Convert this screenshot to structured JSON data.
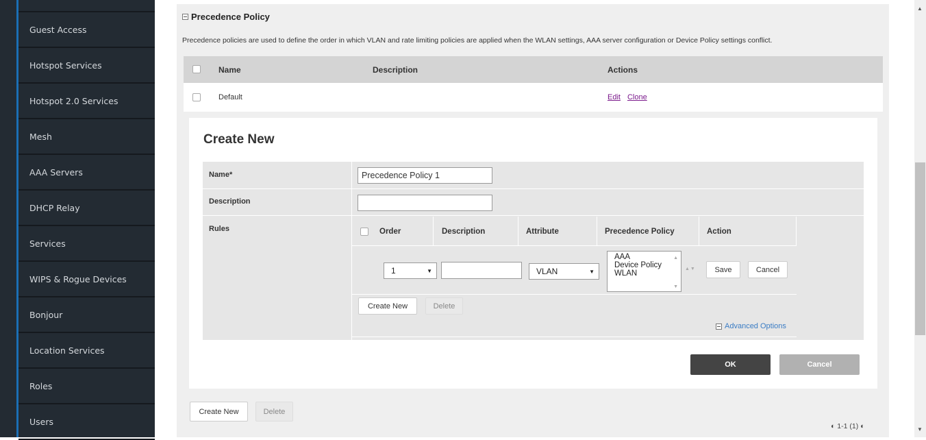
{
  "sidebar": {
    "items": [
      {
        "label": "Guest Access"
      },
      {
        "label": "Hotspot Services"
      },
      {
        "label": "Hotspot 2.0 Services"
      },
      {
        "label": "Mesh"
      },
      {
        "label": "AAA Servers"
      },
      {
        "label": "DHCP Relay"
      },
      {
        "label": "Services"
      },
      {
        "label": "WIPS & Rogue Devices"
      },
      {
        "label": "Bonjour"
      },
      {
        "label": "Location Services"
      },
      {
        "label": "Roles"
      },
      {
        "label": "Users"
      }
    ]
  },
  "section": {
    "title": "Precedence Policy",
    "description": "Precedence policies are used to define the order in which VLAN and rate limiting policies are applied when the WLAN settings, AAA server configuration or Device Policy settings conflict."
  },
  "policy_table": {
    "headers": {
      "name": "Name",
      "description": "Description",
      "actions": "Actions"
    },
    "rows": [
      {
        "name": "Default",
        "description": "",
        "edit": "Edit",
        "clone": "Clone"
      }
    ]
  },
  "create_form": {
    "title": "Create New",
    "name_label": "Name*",
    "name_value": "Precedence Policy 1",
    "description_label": "Description",
    "description_value": "",
    "rules_label": "Rules",
    "rules_headers": {
      "order": "Order",
      "description": "Description",
      "attribute": "Attribute",
      "precedence_policy": "Precedence Policy",
      "action": "Action"
    },
    "rule_edit": {
      "order_value": "1",
      "description_value": "",
      "attribute_value": "VLAN",
      "policy_options": [
        "AAA",
        "Device Policy",
        "WLAN"
      ],
      "save_label": "Save",
      "cancel_label": "Cancel"
    },
    "rules_create_label": "Create New",
    "rules_delete_label": "Delete",
    "advanced_options": "Advanced Options",
    "ok_label": "OK",
    "cancel_label": "Cancel"
  },
  "footer": {
    "create_label": "Create New",
    "delete_label": "Delete",
    "pager": "1-1 (1)"
  }
}
